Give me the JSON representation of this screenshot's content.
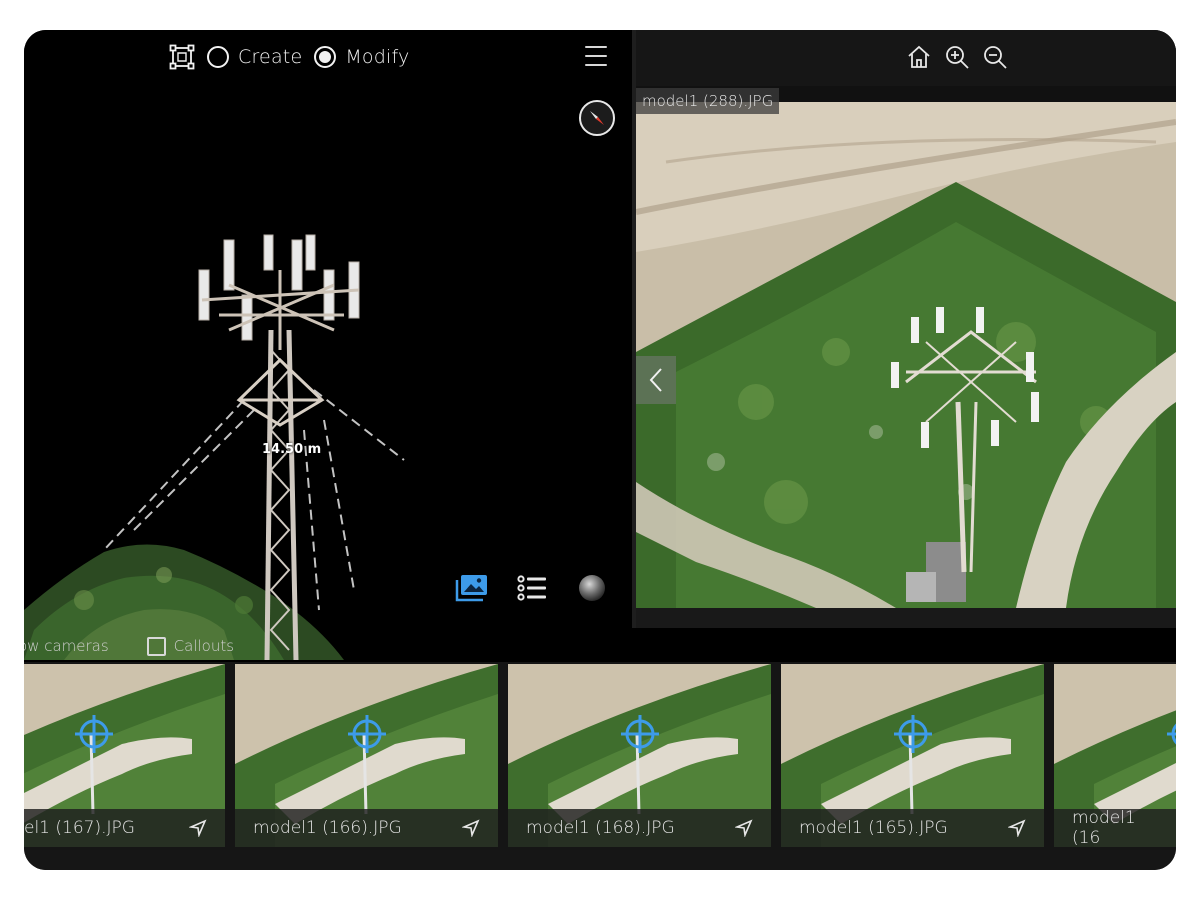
{
  "toolbar": {
    "create_label": "Create",
    "modify_label": "Modify",
    "selected_mode": "Modify"
  },
  "viewer3d": {
    "measurement": "14.50 m"
  },
  "options": {
    "show_cameras_label": "ow cameras",
    "callouts_label": "Callouts"
  },
  "image_viewer": {
    "current_image": "model1 (288).JPG"
  },
  "thumbnails": [
    {
      "name": "el1 (167).JPG"
    },
    {
      "name": "model1 (166).JPG"
    },
    {
      "name": "model1 (168).JPG"
    },
    {
      "name": "model1 (165).JPG"
    },
    {
      "name": "model1 (16"
    }
  ],
  "colors": {
    "accent": "#3d9be9",
    "background": "#000000",
    "panel": "#161616"
  }
}
